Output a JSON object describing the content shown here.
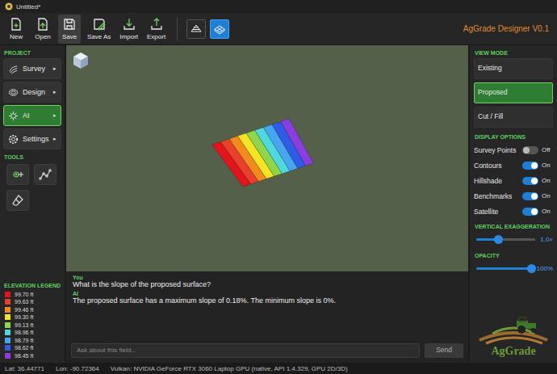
{
  "window": {
    "title": "Untitled*",
    "app_name": "AgGrade Designer V0.1"
  },
  "toolbar": {
    "buttons": [
      {
        "label": "New",
        "hovered": false
      },
      {
        "label": "Open",
        "hovered": false
      },
      {
        "label": "Save",
        "hovered": true
      },
      {
        "label": "Save As",
        "hovered": false
      },
      {
        "label": "Import",
        "hovered": false
      },
      {
        "label": "Export",
        "hovered": false
      }
    ],
    "view_toggles": [
      {
        "selected": false
      },
      {
        "selected": true
      }
    ]
  },
  "sidebar": {
    "project_heading": "PROJECT",
    "items": [
      {
        "label": "Survey",
        "arrow": "▸",
        "selected": false
      },
      {
        "label": "Design",
        "arrow": "▸",
        "selected": false
      },
      {
        "label": "AI",
        "arrow": "▸",
        "selected": true
      },
      {
        "label": "Settings",
        "arrow": "▸",
        "selected": false
      }
    ],
    "tools_heading": "TOOLS"
  },
  "legend": {
    "title": "ELEVATION LEGEND",
    "items": [
      {
        "value": "99.70 ft",
        "color": "#e3141c"
      },
      {
        "value": "99.63 ft",
        "color": "#e8402a"
      },
      {
        "value": "99.46 ft",
        "color": "#f28a1e"
      },
      {
        "value": "99.30 ft",
        "color": "#f4e423"
      },
      {
        "value": "99.13 ft",
        "color": "#8fd64a"
      },
      {
        "value": "98.96 ft",
        "color": "#4fd9df"
      },
      {
        "value": "98.79 ft",
        "color": "#46a6f0"
      },
      {
        "value": "98.62 ft",
        "color": "#2f5ce6"
      },
      {
        "value": "98.45 ft",
        "color": "#8a3ee0"
      }
    ]
  },
  "chat": {
    "messages": [
      {
        "sender": "You",
        "text": "What is the slope of the proposed surface?"
      },
      {
        "sender": "AI",
        "text": "The proposed surface has a maximum slope of 0.18%. The minimum slope is 0%."
      }
    ],
    "input": {
      "placeholder": "Ask about this field..."
    },
    "send_button": "Send"
  },
  "view_mode": {
    "heading": "VIEW MODE",
    "options": [
      {
        "label": "Existing",
        "selected": false
      },
      {
        "label": "Proposed",
        "selected": true
      },
      {
        "label": "Cut / Fill",
        "selected": false
      }
    ]
  },
  "display_options": {
    "heading": "DISPLAY OPTIONS",
    "items": [
      {
        "label": "Survey Points",
        "on": false,
        "state_text": "Off"
      },
      {
        "label": "Contours",
        "on": true,
        "state_text": "On"
      },
      {
        "label": "Hillshade",
        "on": true,
        "state_text": "On"
      },
      {
        "label": "Benchmarks",
        "on": true,
        "state_text": "On"
      },
      {
        "label": "Satellite",
        "on": true,
        "state_text": "On"
      }
    ]
  },
  "sliders": [
    {
      "heading": "VERTICAL EXAGGERATION",
      "level": 0.38,
      "reading": "1.0×"
    },
    {
      "heading": "OPACITY",
      "level": 1,
      "reading": "100%"
    }
  ],
  "logo": {
    "text": "AgGrade"
  },
  "status_bar": {
    "lat": "Lat: 36.44771",
    "lon": "Lon: -90.72364",
    "renderer": "Vulkan: NVIDIA GeForce RTX 3060 Laptop GPU (native, API 1.4.329, GPU 2D/3D)"
  }
}
